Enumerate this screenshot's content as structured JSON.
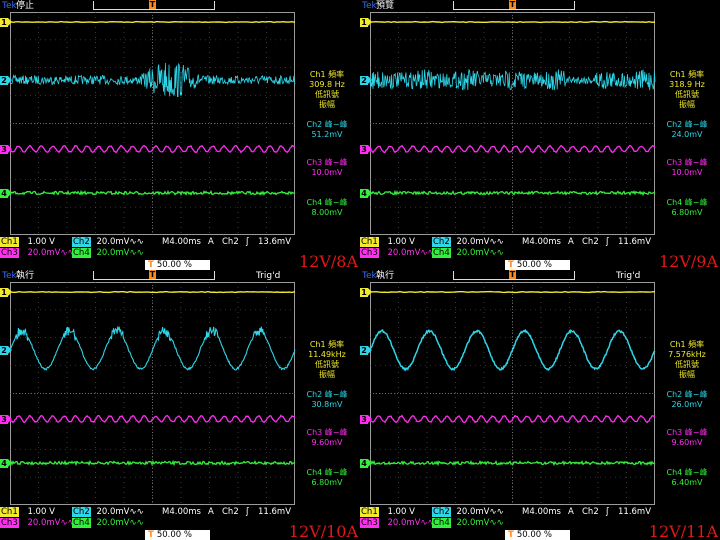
{
  "colors": {
    "ch1": "#f2ea2c",
    "ch2": "#2fd5e8",
    "ch3": "#ff2ef0",
    "ch4": "#33f03c",
    "tek": "#3a6df0",
    "trig": "#ff8a1c",
    "cond": "#e01818"
  },
  "common": {
    "brand": "Tek",
    "trig_glyph": "T",
    "ch1_tag": "Ch1",
    "ch1_scale": "1.00 V",
    "ch2_tag": "Ch2",
    "ch2_scale": "20.0mV",
    "ch3_tag": "Ch3",
    "ch3_scale": "20.0mV",
    "ch4_tag": "Ch4",
    "ch4_scale": "20.0mV",
    "bw_glyph": "∿∿",
    "trig_src": "A",
    "trig_ch": "Ch2",
    "trig_slope": "ʃ",
    "position": "50.00 %",
    "m_freq": "Ch1 頻率",
    "m_lowsig1": "低訊號",
    "m_lowsig2": "振幅",
    "m_ch2pp": "Ch2 峰−峰",
    "m_ch3pp": "Ch3 峰−峰",
    "m_ch4pp": "Ch4 峰−峰"
  },
  "panels": [
    {
      "state": "停止",
      "trigd": "",
      "timebase": "M4.00ms",
      "trig_level": "13.6mV",
      "ch1_freq": "309.8 Hz",
      "ch2_pp": "51.2mV",
      "ch3_pp": "10.0mV",
      "ch4_pp": "8.00mV",
      "condition": "12V/8A",
      "ch2_wave": "noise_burst"
    },
    {
      "state": "預覽",
      "trigd": "",
      "timebase": "M4.00ms",
      "trig_level": "11.6mV",
      "ch1_freq": "318.9 Hz",
      "ch2_pp": "24.0mV",
      "ch3_pp": "10.0mV",
      "ch4_pp": "6.80mV",
      "condition": "12V/9A",
      "ch2_wave": "noise_band"
    },
    {
      "state": "執行",
      "trigd": "Trig'd",
      "timebase": "M4.00ms",
      "trig_level": "11.6mV",
      "ch1_freq": "11.49kHz",
      "ch2_pp": "30.8mV",
      "ch3_pp": "9.60mV",
      "ch4_pp": "6.80mV",
      "condition": "12V/10A",
      "ch2_wave": "sine_noisy"
    },
    {
      "state": "執行",
      "trigd": "Trig'd",
      "timebase": "M4.00ms",
      "trig_level": "11.6mV",
      "ch1_freq": "7.576kHz",
      "ch2_pp": "26.0mV",
      "ch3_pp": "9.60mV",
      "ch4_pp": "6.40mV",
      "condition": "12V/11A",
      "ch2_wave": "sine_clean"
    }
  ]
}
